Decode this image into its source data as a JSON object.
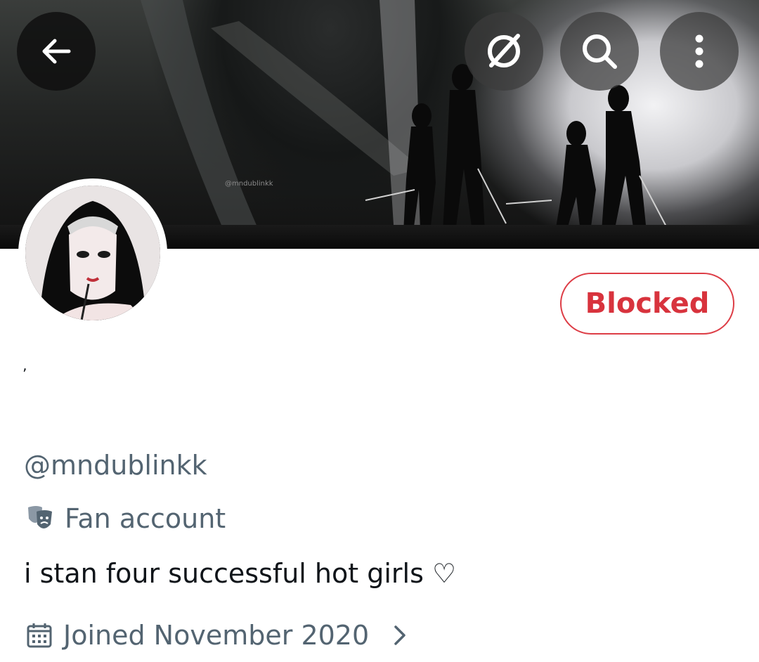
{
  "banner": {
    "watermark": "@mndublinkk"
  },
  "profile": {
    "display_name": "ʼ",
    "handle": "@mndublinkk",
    "category": "Fan account",
    "bio": "i stan four successful hot girls ♡",
    "joined": "Joined November 2020"
  },
  "actions": {
    "blocked_label": "Blocked"
  },
  "icons": {
    "back": "arrow-left-icon",
    "grok": "grok-icon",
    "search": "search-icon",
    "more": "more-vertical-icon",
    "category": "theater-masks-icon",
    "calendar": "calendar-icon",
    "chevron": "chevron-right-icon"
  },
  "colors": {
    "blocked": "#d8333d",
    "muted_text": "#536471",
    "text": "#0f1419"
  }
}
